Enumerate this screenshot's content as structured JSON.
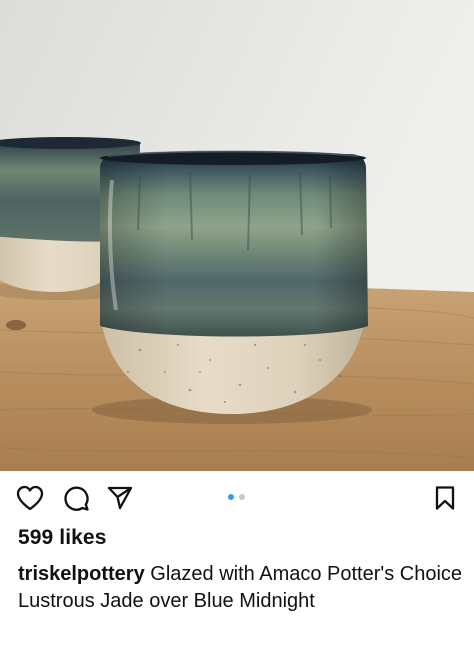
{
  "post": {
    "image_alt": "Two stoneware cups glazed green and blue on a wooden table",
    "likes_text": "599 likes",
    "caption": {
      "username": "triskelpottery",
      "text": "Glazed with Amaco Potter's Choice Lustrous Jade over Blue Midnight"
    },
    "carousel": {
      "total": 2,
      "active_index": 0,
      "active_color": "#3897f0",
      "inactive_color": "#c7c7c7"
    }
  },
  "actions": {
    "like_icon": "heart-outline-icon",
    "comment_icon": "comment-bubble-icon",
    "share_icon": "paper-plane-icon",
    "save_icon": "bookmark-outline-icon"
  }
}
